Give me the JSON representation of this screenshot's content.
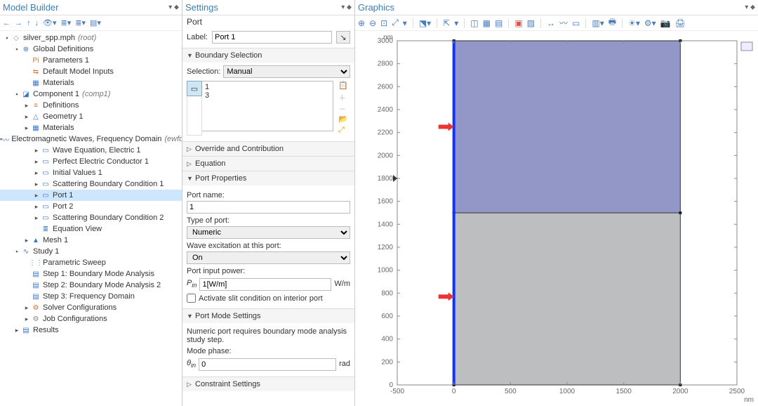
{
  "model_builder": {
    "title": "Model Builder",
    "tree": [
      {
        "d": 0,
        "e": "▪",
        "i": "◇",
        "c": "#a88",
        "t": "silver_spp.mph",
        "suf": "(root)"
      },
      {
        "d": 1,
        "e": "▪",
        "i": "⊕",
        "c": "#3a76c7",
        "t": "Global Definitions"
      },
      {
        "d": 2,
        "e": "",
        "i": "Pi",
        "c": "#c73",
        "t": "Parameters 1"
      },
      {
        "d": 2,
        "e": "",
        "i": "⇆",
        "c": "#c73",
        "t": "Default Model Inputs"
      },
      {
        "d": 2,
        "e": "",
        "i": "▦",
        "c": "#3a76c7",
        "t": "Materials"
      },
      {
        "d": 1,
        "e": "▪",
        "i": "◪",
        "c": "#3a76c7",
        "t": "Component 1",
        "suf": "(comp1)"
      },
      {
        "d": 2,
        "e": "▸",
        "i": "≡",
        "c": "#c73",
        "t": "Definitions"
      },
      {
        "d": 2,
        "e": "▸",
        "i": "△",
        "c": "#3a76c7",
        "t": "Geometry 1"
      },
      {
        "d": 2,
        "e": "▸",
        "i": "▦",
        "c": "#3a76c7",
        "t": "Materials"
      },
      {
        "d": 2,
        "e": "▪",
        "i": "〰",
        "c": "#3a76c7",
        "t": "Electromagnetic Waves, Frequency Domain",
        "suf": "(ewfd)"
      },
      {
        "d": 3,
        "e": "▸",
        "i": "▭",
        "c": "#3a76c7",
        "t": "Wave Equation, Electric 1"
      },
      {
        "d": 3,
        "e": "▸",
        "i": "▭",
        "c": "#3a76c7",
        "t": "Perfect Electric Conductor 1"
      },
      {
        "d": 3,
        "e": "▸",
        "i": "▭",
        "c": "#3a76c7",
        "t": "Initial Values 1"
      },
      {
        "d": 3,
        "e": "▸",
        "i": "▭",
        "c": "#3a76c7",
        "t": "Scattering Boundary Condition 1"
      },
      {
        "d": 3,
        "e": "▸",
        "i": "▭",
        "c": "#3a76c7",
        "t": "Port 1",
        "sel": true
      },
      {
        "d": 3,
        "e": "▸",
        "i": "▭",
        "c": "#3a76c7",
        "t": "Port 2"
      },
      {
        "d": 3,
        "e": "▸",
        "i": "▭",
        "c": "#3a76c7",
        "t": "Scattering Boundary Condition 2"
      },
      {
        "d": 3,
        "e": "",
        "i": "≣",
        "c": "#3a76c7",
        "t": "Equation View"
      },
      {
        "d": 2,
        "e": "▸",
        "i": "▲",
        "c": "#3a76c7",
        "t": "Mesh 1"
      },
      {
        "d": 1,
        "e": "▪",
        "i": "∿",
        "c": "#3a76c7",
        "t": "Study 1"
      },
      {
        "d": 2,
        "e": "",
        "i": "⋮⋮",
        "c": "#3a76c7",
        "t": "Parametric Sweep"
      },
      {
        "d": 2,
        "e": "",
        "i": "▤",
        "c": "#3a76c7",
        "t": "Step 1: Boundary Mode Analysis"
      },
      {
        "d": 2,
        "e": "",
        "i": "▤",
        "c": "#3a76c7",
        "t": "Step 2: Boundary Mode Analysis 2"
      },
      {
        "d": 2,
        "e": "",
        "i": "▤",
        "c": "#3a76c7",
        "t": "Step 3: Frequency Domain"
      },
      {
        "d": 2,
        "e": "▸",
        "i": "⚙",
        "c": "#c73",
        "t": "Solver Configurations"
      },
      {
        "d": 2,
        "e": "▸",
        "i": "⚙",
        "c": "#888",
        "t": "Job Configurations"
      },
      {
        "d": 1,
        "e": "▸",
        "i": "▤",
        "c": "#3a76c7",
        "t": "Results"
      }
    ]
  },
  "settings": {
    "title": "Settings",
    "type": "Port",
    "label_key": "Label:",
    "label_value": "Port 1",
    "sections": {
      "boundary_selection": {
        "title": "Boundary Selection",
        "selection_label": "Selection:",
        "selection_value": "Manual",
        "items": [
          "1",
          "3"
        ]
      },
      "override": "Override and Contribution",
      "equation": "Equation",
      "port_properties": {
        "title": "Port Properties",
        "port_name_label": "Port name:",
        "port_name_value": "1",
        "type_label": "Type of port:",
        "type_value": "Numeric",
        "excitation_label": "Wave excitation at this port:",
        "excitation_value": "On",
        "power_label": "Port input power:",
        "power_symbol": "Pin",
        "power_value": "1[W/m]",
        "power_unit": "W/m",
        "slit_label": "Activate slit condition on interior port"
      },
      "port_mode": {
        "title": "Port Mode Settings",
        "note": "Numeric port requires boundary mode analysis study step.",
        "phase_label": "Mode phase:",
        "phase_symbol": "θin",
        "phase_value": "0",
        "phase_unit": "rad"
      },
      "constraint": "Constraint Settings"
    }
  },
  "graphics": {
    "title": "Graphics",
    "unit_label": "nm"
  },
  "chart_data": {
    "type": "area",
    "xlabel": "nm",
    "ylabel": "nm",
    "xlim": [
      -500,
      2500
    ],
    "ylim": [
      0,
      3000
    ],
    "x_ticks": [
      -500,
      0,
      500,
      1000,
      1500,
      2000,
      2500
    ],
    "y_ticks": [
      0,
      200,
      400,
      600,
      800,
      1000,
      1200,
      1400,
      1600,
      1800,
      2000,
      2200,
      2400,
      2600,
      2800,
      3000
    ],
    "regions": [
      {
        "name": "upper-domain",
        "color": "#9397c8",
        "x": [
          0,
          2000
        ],
        "y": [
          1500,
          3000
        ]
      },
      {
        "name": "lower-domain",
        "color": "#bcbec0",
        "x": [
          0,
          2000
        ],
        "y": [
          0,
          1500
        ]
      }
    ],
    "selected_boundaries": [
      {
        "id": 1,
        "x": 0,
        "y": [
          1500,
          3000
        ],
        "color": "#1033ff"
      },
      {
        "id": 3,
        "x": 0,
        "y": [
          0,
          1500
        ],
        "color": "#1033ff"
      }
    ],
    "arrows": [
      {
        "x": 0,
        "y": 2250,
        "dir": "right"
      },
      {
        "x": 0,
        "y": 770,
        "dir": "right"
      }
    ]
  }
}
